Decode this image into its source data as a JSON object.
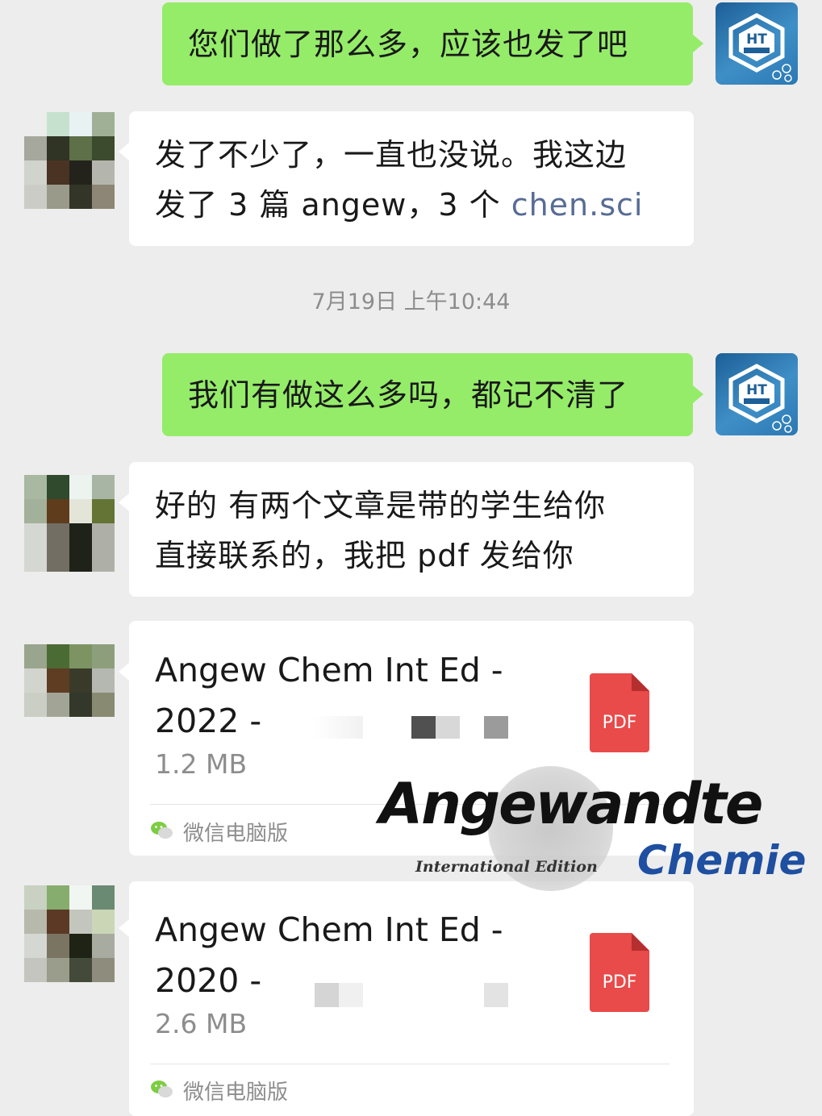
{
  "messages": [
    {
      "id": "m1",
      "side": "out",
      "text": "您们做了那么多，应该也发了吧"
    },
    {
      "id": "m2",
      "side": "in",
      "line1": "发了不少了，一直也没说。我这边",
      "line2_prefix": "发了 3 篇 angew，3 个 ",
      "line2_link": "chen.sci"
    },
    {
      "id": "m3",
      "side": "out",
      "text": "我们有做这么多吗，都记不清了"
    },
    {
      "id": "m4",
      "side": "in",
      "line1": "好的 有两个文章是带的学生给你",
      "line2": "直接联系的，我把 pdf 发给你"
    }
  ],
  "timestamp": "7月19日 上午10:44",
  "files": [
    {
      "title_line1": "Angew Chem Int Ed -",
      "title_line2": "2022 -",
      "size": "1.2 MB",
      "icon_label": "PDF",
      "source": "微信电脑版"
    },
    {
      "title_line1": "Angew Chem Int Ed -",
      "title_line2": "2020 -",
      "size": "2.6 MB",
      "icon_label": "PDF",
      "source": "微信电脑版"
    }
  ],
  "watermark": {
    "big": "Angewandte",
    "small": "International Edition",
    "chem": "Chemie"
  },
  "colors": {
    "background": "#ededed",
    "outgoing_bubble": "#95ec69",
    "incoming_bubble": "#ffffff",
    "link": "#576b95",
    "pdf_red": "#e94a4a",
    "watermark_blue": "#1e4fa0"
  },
  "icons": {
    "avatar_self": "logo-avatar-icon",
    "pdf": "pdf-file-icon",
    "wechat": "wechat-icon"
  }
}
